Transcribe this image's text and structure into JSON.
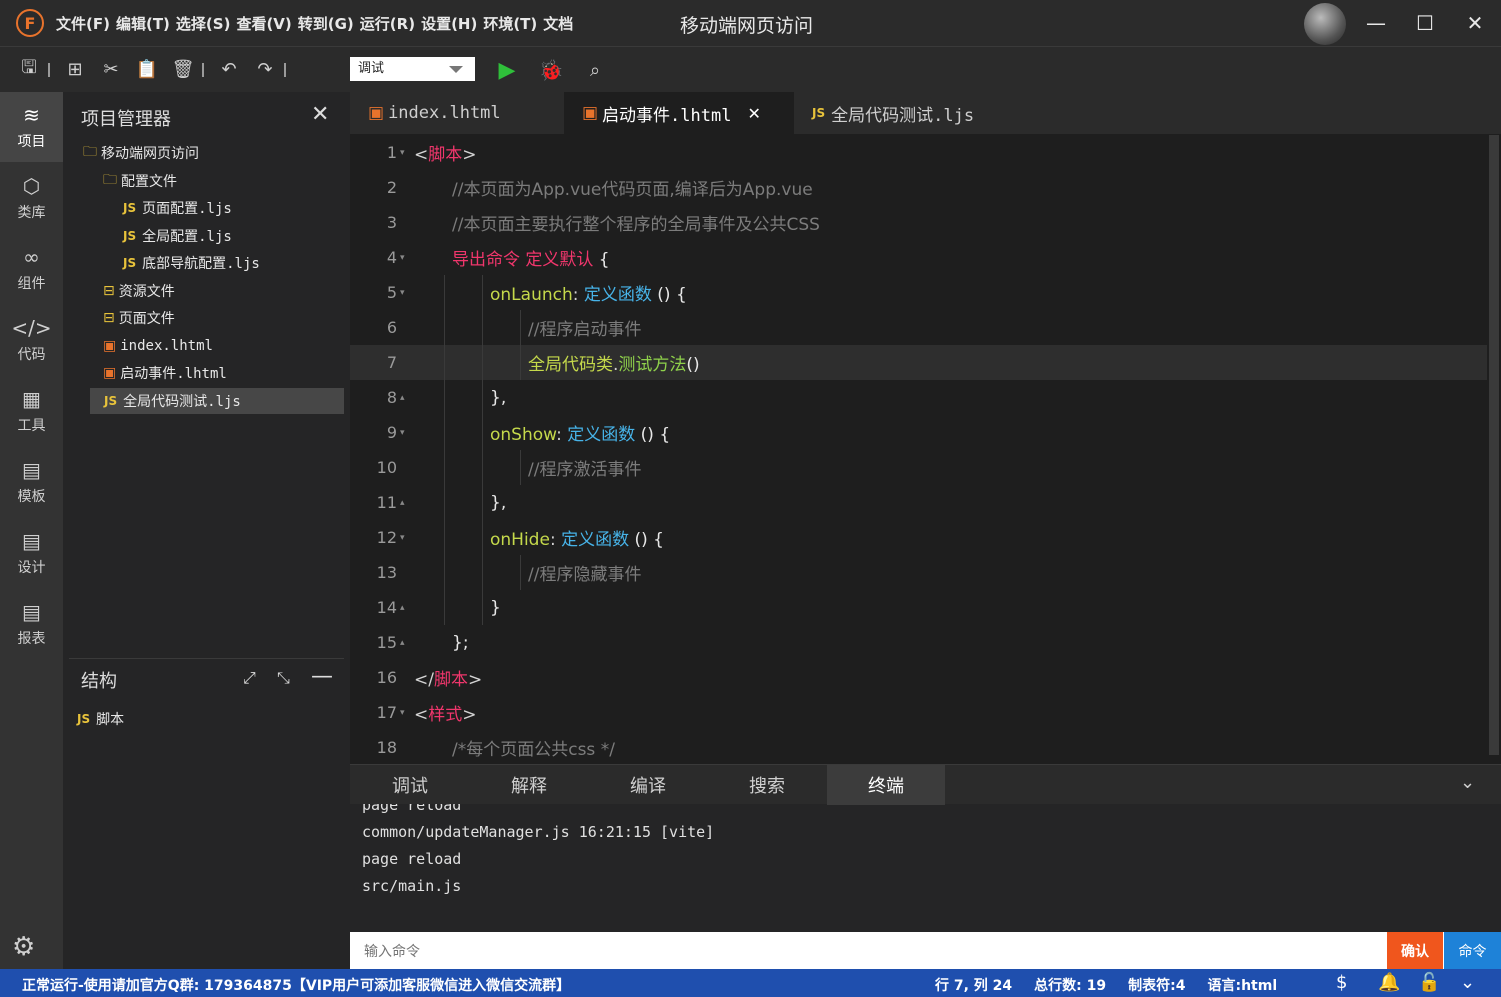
{
  "title_bar": {
    "logo": "F",
    "menus": [
      "文件(F)",
      "编辑(T)",
      "选择(S)",
      "查看(V)",
      "转到(G)",
      "运行(R)",
      "设置(H)",
      "环境(T)",
      "文档"
    ],
    "window_title": "移动端网页访问"
  },
  "toolbar": {
    "run_mode": "调试"
  },
  "left_nav": [
    {
      "icon": "layers-icon",
      "label": "项目"
    },
    {
      "icon": "box-icon",
      "label": "类库"
    },
    {
      "icon": "link-icon",
      "label": "组件"
    },
    {
      "icon": "code-icon",
      "label": "代码"
    },
    {
      "icon": "tools-icon",
      "label": "工具"
    },
    {
      "icon": "template-icon",
      "label": "模板"
    },
    {
      "icon": "design-icon",
      "label": "设计"
    },
    {
      "icon": "report-icon",
      "label": "报表"
    }
  ],
  "explorer": {
    "title": "项目管理器",
    "tree": [
      {
        "type": "folder",
        "name": "移动端网页访问",
        "level": 0
      },
      {
        "type": "folder",
        "name": "配置文件",
        "level": 1
      },
      {
        "type": "js",
        "name": "页面配置.ljs",
        "level": 2
      },
      {
        "type": "js",
        "name": "全局配置.ljs",
        "level": 2
      },
      {
        "type": "js",
        "name": "底部导航配置.ljs",
        "level": 2
      },
      {
        "type": "folder2",
        "name": "资源文件",
        "level": 1
      },
      {
        "type": "folder2",
        "name": "页面文件",
        "level": 1
      },
      {
        "type": "html",
        "name": "index.lhtml",
        "level": 1
      },
      {
        "type": "html",
        "name": "启动事件.lhtml",
        "level": 1
      },
      {
        "type": "js",
        "name": "全局代码测试.ljs",
        "level": 1,
        "selected": true
      }
    ]
  },
  "structure": {
    "title": "结构",
    "items": [
      {
        "type": "js",
        "name": "脚本"
      }
    ]
  },
  "editor": {
    "tabs": [
      {
        "type": "html",
        "name": "index.lhtml",
        "active": false
      },
      {
        "type": "html",
        "name": "启动事件.lhtml",
        "active": true
      },
      {
        "type": "js",
        "name": "全局代码测试.ljs",
        "active": false
      }
    ],
    "current_line": 7,
    "lines": [
      {
        "n": "1",
        "fold": "▾",
        "indent": 0,
        "parts": [
          [
            "<",
            "#d4d4d4"
          ],
          [
            "脚本",
            "#f0366c"
          ],
          [
            ">",
            "#d4d4d4"
          ]
        ]
      },
      {
        "n": "2",
        "fold": "",
        "indent": 1,
        "parts": [
          [
            "//本页面为App.vue代码页面,编译后为App.vue",
            "#7c7c7c"
          ]
        ]
      },
      {
        "n": "3",
        "fold": "",
        "indent": 1,
        "parts": [
          [
            "//本页面主要执行整个程序的全局事件及公共CSS",
            "#7c7c7c"
          ]
        ]
      },
      {
        "n": "4",
        "fold": "▾",
        "indent": 1,
        "parts": [
          [
            "导出命令",
            "#f0366c"
          ],
          [
            " ",
            "#d4d4d4"
          ],
          [
            "定义默认",
            "#f0366c"
          ],
          [
            " {",
            "#e8e8e8"
          ]
        ]
      },
      {
        "n": "5",
        "fold": "▾",
        "indent": 2,
        "parts": [
          [
            "onLaunch",
            "#c5d94b"
          ],
          [
            ": ",
            "#d4d4d4"
          ],
          [
            "定义函数",
            "#47b3e8"
          ],
          [
            " () {",
            "#e8e8e8"
          ]
        ]
      },
      {
        "n": "6",
        "fold": "",
        "indent": 3,
        "parts": [
          [
            "//程序启动事件",
            "#7c7c7c"
          ]
        ]
      },
      {
        "n": "7",
        "fold": "",
        "indent": 3,
        "parts": [
          [
            "全局代码类",
            "#c5d94b"
          ],
          [
            ".",
            "#d4d4d4"
          ],
          [
            "测试方法",
            "#8fd14b"
          ],
          [
            "()",
            "#e8e8e8"
          ]
        ]
      },
      {
        "n": "8",
        "fold": "▴",
        "indent": 2,
        "parts": [
          [
            "},",
            "#e8e8e8"
          ]
        ]
      },
      {
        "n": "9",
        "fold": "▾",
        "indent": 2,
        "parts": [
          [
            "onShow",
            "#c5d94b"
          ],
          [
            ": ",
            "#d4d4d4"
          ],
          [
            "定义函数",
            "#47b3e8"
          ],
          [
            " () {",
            "#e8e8e8"
          ]
        ]
      },
      {
        "n": "10",
        "fold": "",
        "indent": 3,
        "parts": [
          [
            "//程序激活事件",
            "#7c7c7c"
          ]
        ]
      },
      {
        "n": "11",
        "fold": "▴",
        "indent": 2,
        "parts": [
          [
            "},",
            "#e8e8e8"
          ]
        ]
      },
      {
        "n": "12",
        "fold": "▾",
        "indent": 2,
        "parts": [
          [
            "onHide",
            "#c5d94b"
          ],
          [
            ": ",
            "#d4d4d4"
          ],
          [
            "定义函数",
            "#47b3e8"
          ],
          [
            " () {",
            "#e8e8e8"
          ]
        ]
      },
      {
        "n": "13",
        "fold": "",
        "indent": 3,
        "parts": [
          [
            "//程序隐藏事件",
            "#7c7c7c"
          ]
        ]
      },
      {
        "n": "14",
        "fold": "▴",
        "indent": 2,
        "parts": [
          [
            "}",
            "#e8e8e8"
          ]
        ]
      },
      {
        "n": "15",
        "fold": "▴",
        "indent": 1,
        "parts": [
          [
            "};",
            "#e8e8e8"
          ]
        ]
      },
      {
        "n": "16",
        "fold": "",
        "indent": 0,
        "parts": [
          [
            "</",
            "#d4d4d4"
          ],
          [
            "脚本",
            "#f0366c"
          ],
          [
            ">",
            "#d4d4d4"
          ]
        ]
      },
      {
        "n": "17",
        "fold": "▾",
        "indent": 0,
        "parts": [
          [
            "<",
            "#d4d4d4"
          ],
          [
            "样式",
            "#f0366c"
          ],
          [
            ">",
            "#d4d4d4"
          ]
        ]
      },
      {
        "n": "18",
        "fold": "",
        "indent": 1,
        "parts": [
          [
            "/*每个页面公共css */",
            "#7c7c7c"
          ]
        ]
      }
    ]
  },
  "bottom_panel": {
    "tabs": [
      "调试",
      "解释",
      "编译",
      "搜索",
      "终端"
    ],
    "active_tab": 4,
    "terminal_lines": [
      "page reload",
      "common/updateManager.js 16:21:15 [vite]",
      "page reload",
      "src/main.js"
    ],
    "command_placeholder": "输入命令",
    "confirm_label": "确认",
    "command_label": "命令"
  },
  "status_bar": {
    "message": "正常运行-使用请加官方Q群: 179364875【VIP用户可添加客服微信进入微信交流群】",
    "position": "行 7, 列 24",
    "total_lines": "总行数: 19",
    "tab_size": "制表符:4",
    "language": "语言:html"
  },
  "colors": {
    "accent_orange": "#f0561d",
    "accent_blue": "#1e82d8",
    "status_bg": "#1f4fae",
    "keyword": "#f0366c",
    "function": "#47b3e8"
  }
}
